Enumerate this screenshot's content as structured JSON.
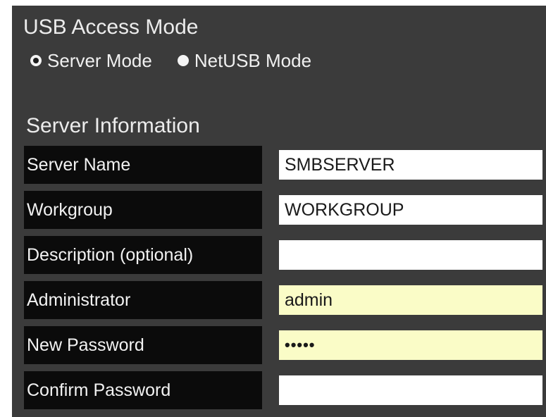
{
  "usb_access": {
    "title": "USB Access Mode",
    "options": [
      {
        "label": "Server Mode",
        "selected": true
      },
      {
        "label": "NetUSB Mode",
        "selected": false
      }
    ]
  },
  "server_info": {
    "title": "Server Information",
    "fields": [
      {
        "label": "Server Name",
        "value": "SMBSERVER",
        "type": "text"
      },
      {
        "label": "Workgroup",
        "value": "WORKGROUP",
        "type": "text"
      },
      {
        "label": "Description (optional)",
        "value": "",
        "type": "text"
      },
      {
        "label": "Administrator",
        "value": "admin",
        "type": "text",
        "autofill": true
      },
      {
        "label": "New Password",
        "value": "•••••",
        "type": "password",
        "autofill": true
      },
      {
        "label": "Confirm Password",
        "value": "",
        "type": "password"
      }
    ]
  },
  "colors": {
    "panel_bg": "#3b3b3b",
    "label_bg": "#0b0b0b",
    "autofill_bg": "#fafcc7",
    "text": "#f2f2f2"
  }
}
